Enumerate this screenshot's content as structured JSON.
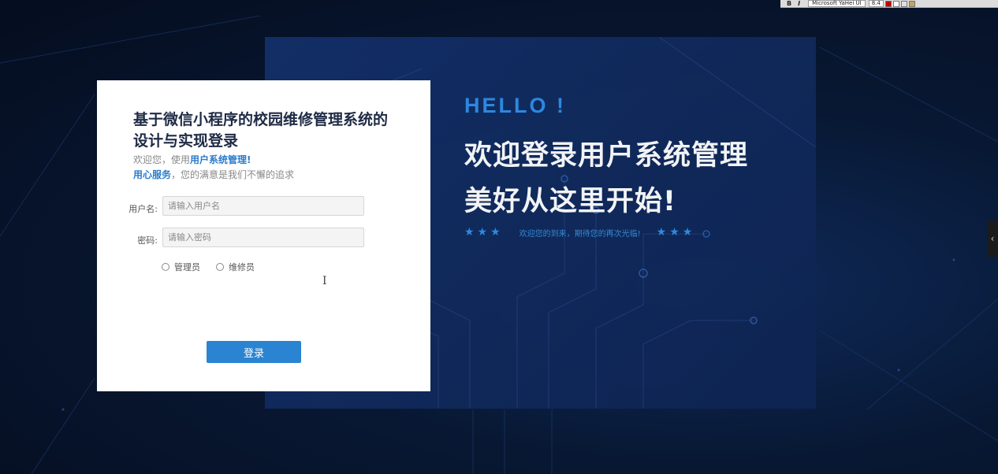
{
  "login": {
    "title": "基于微信小程序的校园维修管理系统的设计与实现登录",
    "subtitle_line1_prefix": "欢迎您，使用",
    "subtitle_line1_accent": "用户系统管理!",
    "subtitle_line2_accent": "用心服务",
    "subtitle_line2_rest": "，您的满意是我们不懈的追求",
    "username_label": "用户名:",
    "username_placeholder": "请输入用户名",
    "password_label": "密码:",
    "password_placeholder": "请输入密码",
    "roles": [
      {
        "label": "管理员"
      },
      {
        "label": "维修员"
      }
    ],
    "login_button": "登录"
  },
  "hero": {
    "hello": "HELLO !",
    "line1": "欢迎登录用户系统管理",
    "line2": "美好从这里开始!",
    "stars_left": "★★★",
    "tagline": "欢迎您的到来，期待您的再次光临!",
    "stars_right": "★★★"
  },
  "toolbar": {
    "bold": "B",
    "italic": "I",
    "font_name": "Microsoft YaHei UI",
    "font_size": "8.4"
  },
  "colors": {
    "accent": "#2b84d1",
    "hello": "#2f8fe8",
    "panel": "#13306a",
    "background": "#081833"
  }
}
